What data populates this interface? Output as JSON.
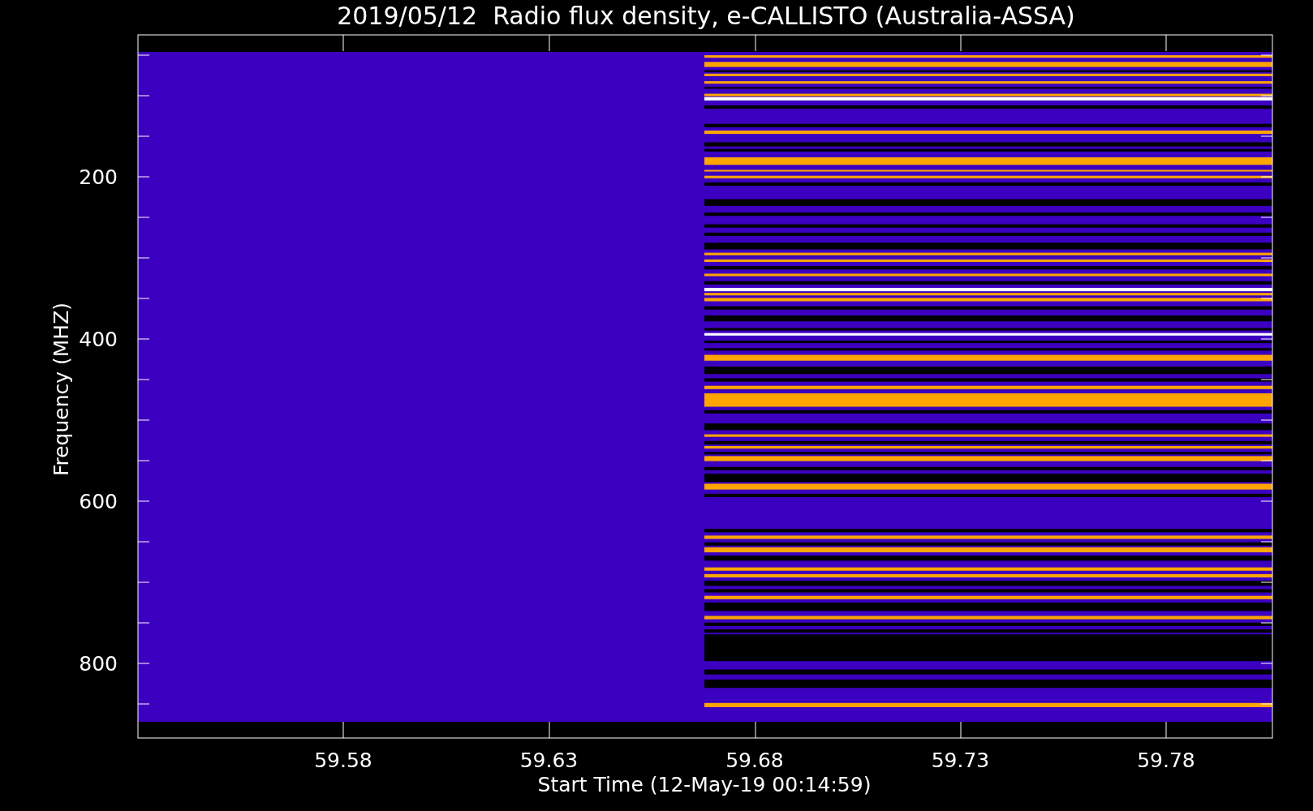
{
  "title": "2019/05/12  Radio flux density, e-CALLISTO (Australia-ASSA)",
  "ylabel": "Frequency (MHZ)",
  "xlabel": "Start Time (12-May-19 00:14:59)",
  "yticks": [
    "200",
    "400",
    "600",
    "800"
  ],
  "xticks": [
    "59.58",
    "59.63",
    "59.68",
    "59.73",
    "59.78"
  ]
}
